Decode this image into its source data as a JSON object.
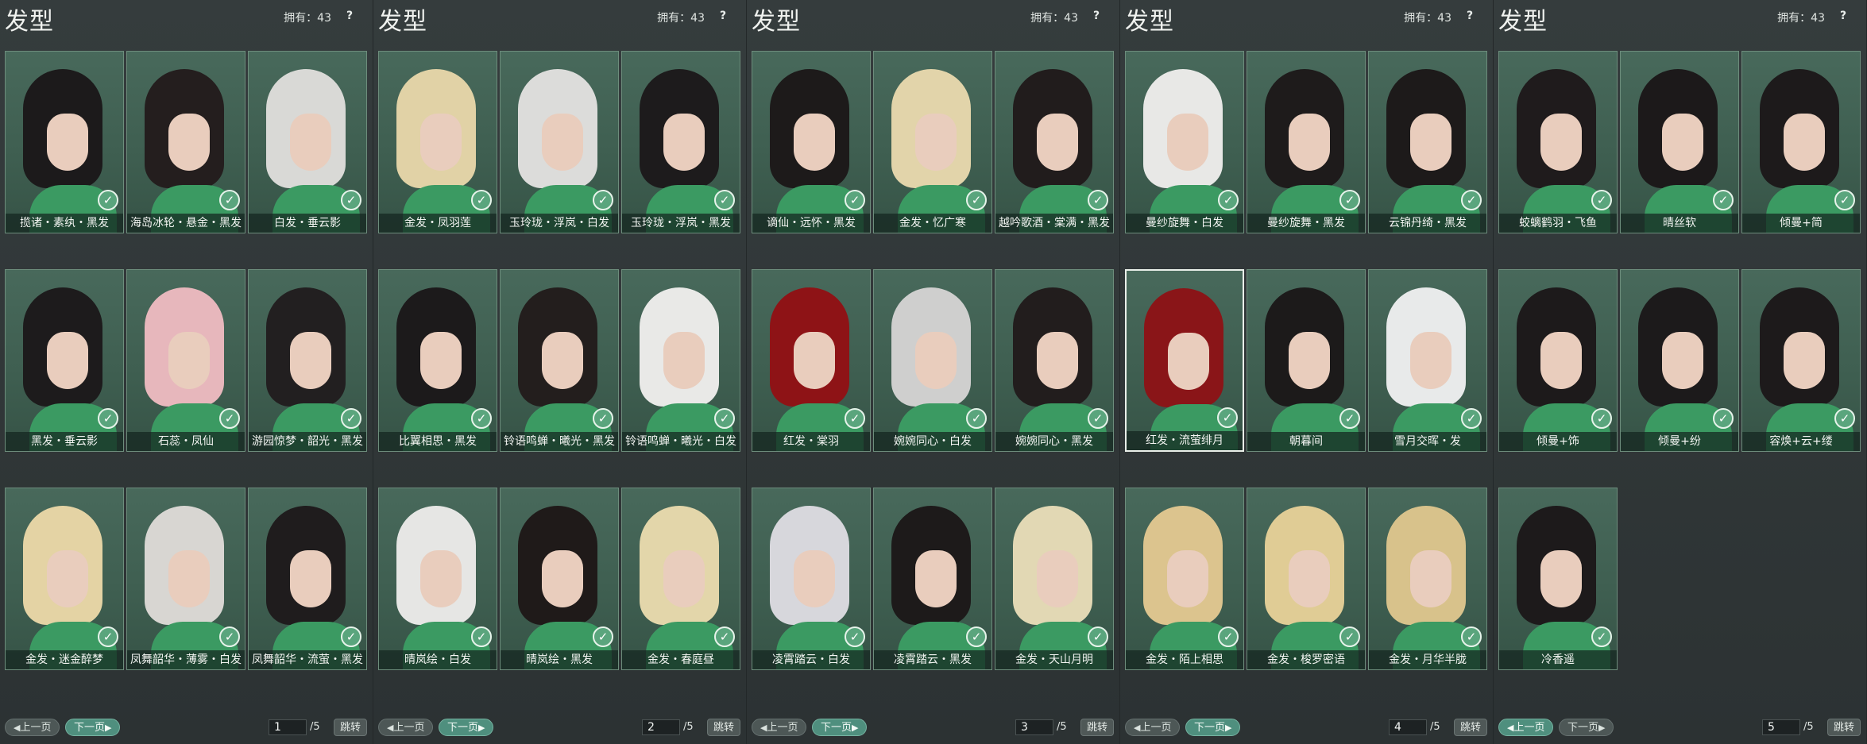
{
  "panels": [
    {
      "title": "发型",
      "owned": "拥有：43",
      "help": "?",
      "items": [
        "揽诸・素纨・黑发",
        "海岛冰轮・悬金・黑发",
        "白发・垂云影",
        "黑发・垂云影",
        "石蕊・凤仙",
        "游园惊梦・韶光・黑发",
        "金发・迷金醉梦",
        "凤舞韶华・薄雾・白发",
        "凤舞韶华・流萤・黑发"
      ],
      "page": "1",
      "total": "/5",
      "prev": "上一页",
      "next": "下一页",
      "jump": "跳转",
      "active_nav": "next",
      "selected": -1
    },
    {
      "title": "发型",
      "owned": "拥有：43",
      "help": "?",
      "items": [
        "金发・凤羽莲",
        "玉玲珑・浮岚・白发",
        "玉玲珑・浮岚・黑发",
        "比翼相思・黑发",
        "铃语鸣蝉・曦光・黑发",
        "铃语鸣蝉・曦光・白发",
        "晴岚绘・白发",
        "晴岚绘・黑发",
        "金发・春庭昼"
      ],
      "page": "2",
      "total": "/5",
      "prev": "上一页",
      "next": "下一页",
      "jump": "跳转",
      "active_nav": "next",
      "selected": -1
    },
    {
      "title": "发型",
      "owned": "拥有：43",
      "help": "?",
      "items": [
        "谪仙・远怀・黑发",
        "金发・忆广寒",
        "越吟歌酒・棠满・黑发",
        "红发・棠羽",
        "婉婉同心・白发",
        "婉婉同心・黑发",
        "凌霄踏云・白发",
        "凌霄踏云・黑发",
        "金发・天山月明"
      ],
      "page": "3",
      "total": "/5",
      "prev": "上一页",
      "next": "下一页",
      "jump": "跳转",
      "active_nav": "next",
      "selected": -1
    },
    {
      "title": "发型",
      "owned": "拥有：43",
      "help": "?",
      "items": [
        "曼纱旋舞・白发",
        "曼纱旋舞・黑发",
        "云锦丹绮・黑发",
        "红发・流萤绯月",
        "朝暮间",
        "雪月交晖・发",
        "金发・陌上相思",
        "金发・梭罗密语",
        "金发・月华半胧"
      ],
      "page": "4",
      "total": "/5",
      "prev": "上一页",
      "next": "下一页",
      "jump": "跳转",
      "active_nav": "next",
      "selected": 3
    },
    {
      "title": "发型",
      "owned": "拥有：43",
      "help": "?",
      "items": [
        "蛟螭鹤羽・飞鱼",
        "晴丝软",
        "倾曼+简",
        "倾曼+饰",
        "倾曼+纷",
        "容焕+云+缕",
        "冷香遥"
      ],
      "page": "5",
      "total": "/5",
      "prev": "上一页",
      "next": "下一页",
      "jump": "跳转",
      "active_nav": "prev",
      "selected": -1
    }
  ],
  "hair_colors": [
    [
      "#1c1a1b",
      "#241e1e",
      "#d9d9d6",
      "#1d1b1c",
      "#e7b7bc",
      "#221f20",
      "#e4d3a4",
      "#d8d6d2",
      "#1f1c1d"
    ],
    [
      "#e1d2a6",
      "#dcdcda",
      "#1d1b1c",
      "#1c1a1b",
      "#231e1d",
      "#e9e9e7",
      "#e6e6e4",
      "#1f1a19",
      "#e3d6aa"
    ],
    [
      "#1d1a1a",
      "#e2d4aa",
      "#211c1c",
      "#8e1316",
      "#cfcfce",
      "#221d1d",
      "#d7d7dc",
      "#1d1a1a",
      "#e2d8b4"
    ],
    [
      "#e8e8e6",
      "#1e1b1b",
      "#1d1a1a",
      "#8a1518",
      "#1c1a1a",
      "#e8eaea",
      "#dcc48e",
      "#e0cc95",
      "#d8c28b"
    ],
    [
      "#1f1b1c",
      "#1c191a",
      "#1d1a1b",
      "#1d1a1b",
      "#1c1a1b",
      "#1d1a1b",
      "#1d1a1b"
    ]
  ]
}
